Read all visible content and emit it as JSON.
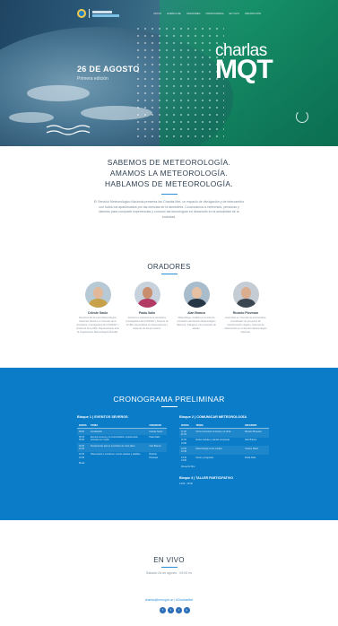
{
  "nav": {
    "items": [
      "INICIO",
      "ACERCA DE",
      "ORADORES",
      "CRONOGRAMA",
      "EN VIVO",
      "INSCRIPCIÓN"
    ]
  },
  "hero": {
    "date": "26 DE AGOSTO",
    "subtitle": "Primera edición",
    "brand_top": "charlas",
    "brand_bottom": "MQT"
  },
  "intro": {
    "heading_1": "SABEMOS DE METEOROLOGÍA.",
    "heading_2": "AMAMOS LA METEOROLOGÍA.",
    "heading_3": "HABLAMOS DE METEOROLOGÍA.",
    "paragraph": "El Servicio Meteorológico Nacional presenta las Charlas Met, un espacio de divulgación y de intercambio con todos los apasionados por las ciencias de la atmósfera. Convocamos a referentes, personas y talentos para compartir experiencias y conocer las tecnologías en desarrollo en la actualidad de la sociedad."
  },
  "speakers": {
    "title": "ORADORES",
    "items": [
      {
        "name": "Celeste Saulo",
        "bio": "Directora del Servicio Meteorológico Nacional. Doctora en Ciencias de la Atmósfera. Investigadora del CONICET y profesora de la UBA. Representante ante la Organización Meteorológica Mundial.",
        "skin": "#e2b89a",
        "shirt": "#c7a24a",
        "bg": "#b8c9d6"
      },
      {
        "name": "Paola Salio",
        "bio": "Doctora en Ciencias de la Atmósfera, investigadora del CONICET y docente de la UBA. Especialista en observaciones y sistemas de tiempo severo.",
        "skin": "#c98e6d",
        "shirt": "#b23a63",
        "bg": "#c7d2dc"
      },
      {
        "name": "Alan Branca",
        "bio": "Meteorólogo. Analista en el área de pronóstico del Servicio Meteorológico Nacional. Trabaja en comunicación de alertas.",
        "skin": "#e6c0a3",
        "shirt": "#263645",
        "bg": "#a9bccb"
      },
      {
        "name": "Ricardo Piovesan",
        "bio": "Licenciado en Ciencias de la Atmósfera. Coordinador de proyectos de transformación digital y sistemas de observación en el Servicio Meteorológico Nacional.",
        "skin": "#d9ad8e",
        "shirt": "#3c4650",
        "bg": "#c5ccd3"
      }
    ]
  },
  "agenda": {
    "title": "CRONOGRAMA PRELIMINAR",
    "block1": {
      "title": "Bloque 1 | EVENTOS SEVEROS",
      "cols": [
        "HORA",
        "TEMA",
        "ORADOR"
      ],
      "rows": [
        [
          "09:00",
          "Acreditación",
          "Celeste Saulo"
        ],
        [
          "09:15\n09:45",
          "Eventos severos y su comunicación: experiencias recientes en el país",
          "Paola Salio"
        ],
        [
          "09:45\n10:15",
          "Herramientas para el pronóstico de corto plazo",
          "Alan Branca"
        ],
        [
          "10:15\n10:45",
          "Observación y monitoreo: nuevos radares y satélites",
          "Ricardo Piovesan"
        ]
      ],
      "note": "Break"
    },
    "block2": {
      "title": "Bloque 2 | COMUNICAR METEOROLOGÍA",
      "cols": [
        "HORA",
        "TEMA",
        "ORADOR"
      ],
      "rows": [
        [
          "11:00\n11:30",
          "Cómo comunicar el tiempo y el clima",
          "Ricardo Piovesan"
        ],
        [
          "11:30\n12:00",
          "Redes sociales y alertas tempranas",
          "Alan Branca"
        ],
        [
          "12:00\n12:30",
          "Meteorología en los medios",
          "Celeste Saulo"
        ],
        [
          "12:30\n13:00",
          "Cierre y preguntas",
          "Paola Salio"
        ]
      ],
      "note": "Almuerzo libre",
      "taller": "Bloque 3 | TALLER PARTICIPATIVO",
      "taller_time": "14:00 - 16:00"
    }
  },
  "live": {
    "title": "EN VIVO",
    "date": "Sábado 26 de agosto · 09:00 hs",
    "contact": "charlas@smn.gob.ar | #CharlasMet",
    "social": [
      "f",
      "t",
      "i",
      "y"
    ]
  }
}
